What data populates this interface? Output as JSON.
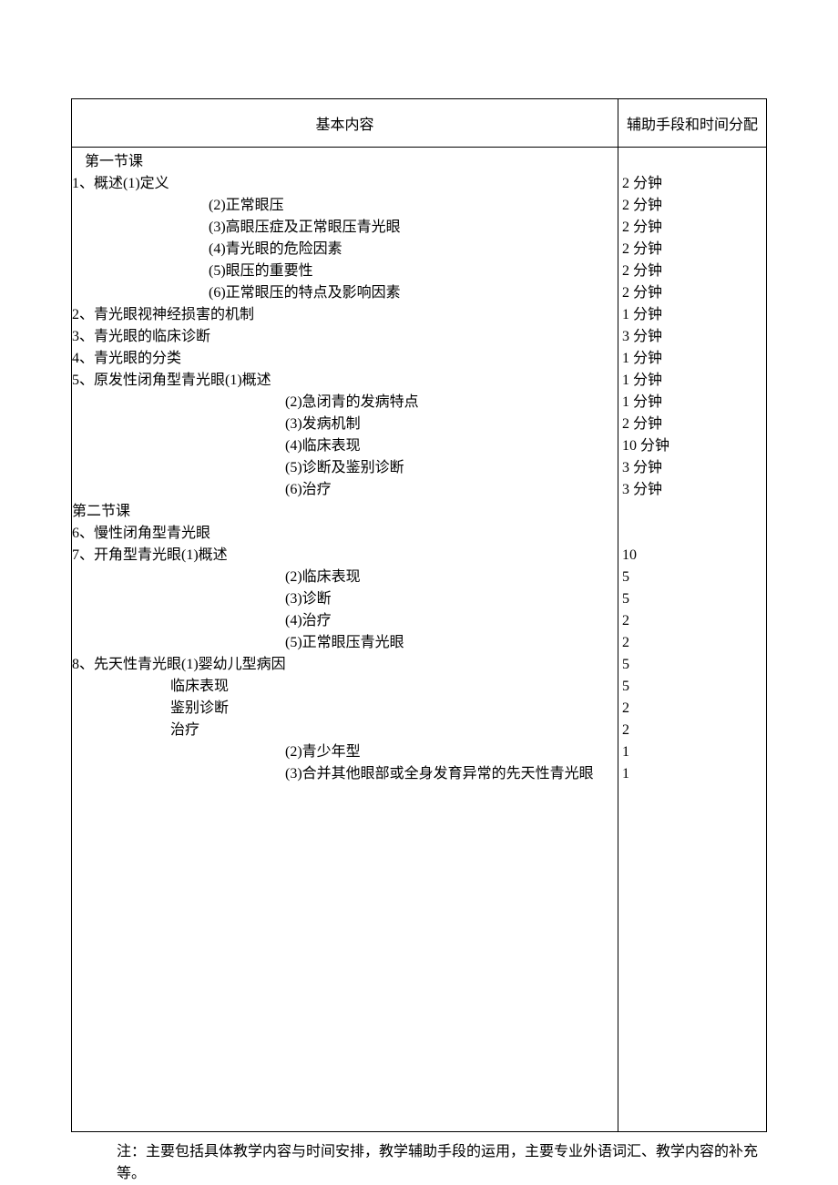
{
  "header": {
    "content_label": "基本内容",
    "aux_label": "辅助手段和时间分配"
  },
  "rows": [
    {
      "text": "第一节课",
      "cls": "indent1",
      "time": ""
    },
    {
      "text": "1、概述(1)定义",
      "cls": "indent-item",
      "time": "2 分钟"
    },
    {
      "text": "(2)正常眼压",
      "cls": "indent2",
      "time": "2 分钟"
    },
    {
      "text": "(3)高眼压症及正常眼压青光眼",
      "cls": "indent2",
      "time": "2 分钟"
    },
    {
      "text": "(4)青光眼的危险因素",
      "cls": "indent2",
      "time": "2 分钟"
    },
    {
      "text": "(5)眼压的重要性",
      "cls": "indent2",
      "time": "2 分钟"
    },
    {
      "text": "(6)正常眼压的特点及影响因素",
      "cls": "indent2",
      "time": "2 分钟"
    },
    {
      "text": "2、青光眼视神经损害的机制",
      "cls": "indent-item",
      "time": "1 分钟"
    },
    {
      "text": "3、青光眼的临床诊断",
      "cls": "indent-item",
      "time": "3 分钟"
    },
    {
      "text": "4、青光眼的分类",
      "cls": "indent-item",
      "time": "1 分钟"
    },
    {
      "text": "5、原发性闭角型青光眼(1)概述",
      "cls": "indent-item",
      "time": "1 分钟"
    },
    {
      "text": "(2)急闭青的发病特点",
      "cls": "indent3",
      "time": "1 分钟"
    },
    {
      "text": "(3)发病机制",
      "cls": "indent3",
      "time": "2 分钟"
    },
    {
      "text": "(4)临床表现",
      "cls": "indent3",
      "time": "10 分钟"
    },
    {
      "text": "(5)诊断及鉴别诊断",
      "cls": "indent3",
      "time": "3 分钟"
    },
    {
      "text": "(6)治疗",
      "cls": "indent3",
      "time": "3 分钟"
    },
    {
      "text": "第二节课",
      "cls": "indent-item",
      "time": ""
    },
    {
      "text": "6、慢性闭角型青光眼",
      "cls": "indent-item",
      "time": ""
    },
    {
      "text": "7、开角型青光眼(1)概述",
      "cls": "indent-item",
      "time": "10"
    },
    {
      "text": "(2)临床表现",
      "cls": "indent3",
      "time": "5"
    },
    {
      "text": "(3)诊断",
      "cls": "indent3",
      "time": "5"
    },
    {
      "text": "(4)治疗",
      "cls": "indent3",
      "time": "2"
    },
    {
      "text": "(5)正常眼压青光眼",
      "cls": "indent3",
      "time": "2"
    },
    {
      "text": "8、先天性青光眼(1)婴幼儿型病因",
      "cls": "indent-item",
      "time": "5"
    },
    {
      "text": "                           临床表现",
      "cls": "indent-item",
      "time": "5"
    },
    {
      "text": "                           鉴别诊断",
      "cls": "indent-item",
      "time": "2"
    },
    {
      "text": "                           治疗",
      "cls": "indent-item",
      "time": "2"
    },
    {
      "text": "(2)青少年型",
      "cls": "indent3",
      "time": "1"
    },
    {
      "text": "(3)合并其他眼部或全身发育异常的先天性青光眼",
      "cls": "indent3",
      "time": "1"
    }
  ],
  "footer_note": "注：主要包括具体教学内容与时间安排，教学辅助手段的运用，主要专业外语词汇、教学内容的补充等。"
}
